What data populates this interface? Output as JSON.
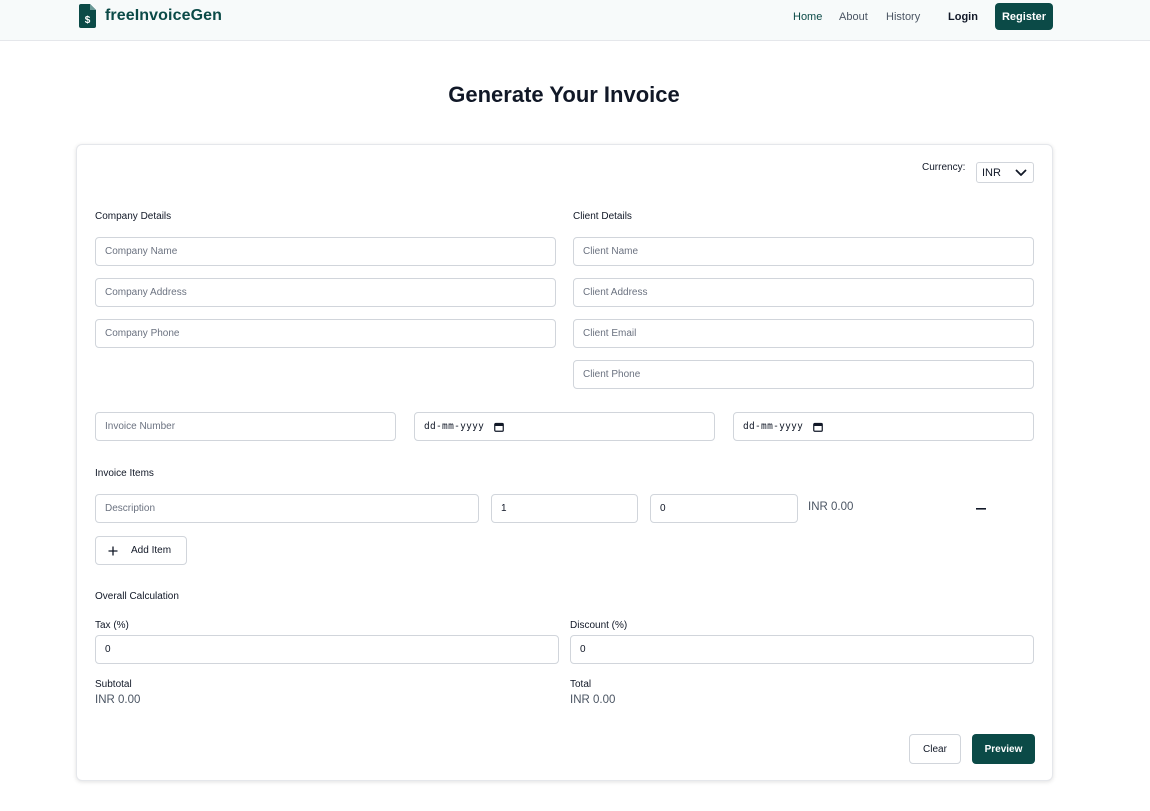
{
  "header": {
    "brand": "freeInvoiceGen",
    "nav": [
      {
        "label": "Home",
        "active": true
      },
      {
        "label": "About",
        "active": false
      },
      {
        "label": "History",
        "active": false
      }
    ],
    "login_label": "Login",
    "register_label": "Register"
  },
  "page": {
    "title": "Generate Your Invoice"
  },
  "currency": {
    "label": "Currency:",
    "selected": "INR"
  },
  "company": {
    "heading": "Company Details",
    "name_placeholder": "Company Name",
    "address_placeholder": "Company Address",
    "phone_placeholder": "Company Phone"
  },
  "client": {
    "heading": "Client Details",
    "name_placeholder": "Client Name",
    "address_placeholder": "Client Address",
    "email_placeholder": "Client Email",
    "phone_placeholder": "Client Phone"
  },
  "invoice": {
    "number_placeholder": "Invoice Number",
    "invoice_date_text": "dd-mm-yyyy",
    "due_date_text": "dd-mm-yyyy"
  },
  "items": {
    "heading": "Invoice Items",
    "rows": [
      {
        "description_placeholder": "Description",
        "quantity": "1",
        "price": "0",
        "amount": "INR 0.00"
      }
    ],
    "add_label": "Add Item"
  },
  "overall": {
    "heading": "Overall Calculation",
    "tax_label": "Tax (%)",
    "tax_value": "0",
    "discount_label": "Discount (%)",
    "discount_value": "0",
    "subtotal_label": "Subtotal",
    "subtotal_value": "INR 0.00",
    "total_label": "Total",
    "total_value": "INR 0.00"
  },
  "actions": {
    "clear_label": "Clear",
    "preview_label": "Preview"
  },
  "colors": {
    "brand": "#0b4a47",
    "header_bg": "#f7fafa",
    "border": "#d1d5db"
  }
}
